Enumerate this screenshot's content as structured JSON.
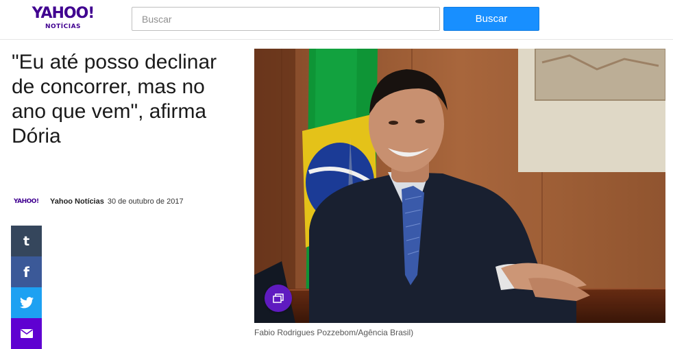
{
  "header": {
    "logo_main": "YAHOO!",
    "logo_sub": "NOTÍCIAS",
    "search_placeholder": "Buscar",
    "search_value": "",
    "search_button": "Buscar"
  },
  "article": {
    "headline": "\"Eu até posso declinar de concorrer, mas no ano que vem\", afirma Dória",
    "byline_logo": "YAHOO!",
    "source": "Yahoo Notícias",
    "date": "30 de outubro de 2017",
    "image_caption": "Fabio Rodrigues Pozzebom/Agência Brasil)"
  },
  "share": {
    "tumblr_glyph": "t",
    "facebook_glyph": "f",
    "icons": [
      "tumblr-icon",
      "facebook-icon",
      "twitter-icon",
      "mail-icon"
    ]
  },
  "photo": {
    "gallery_icon": "gallery-icon"
  },
  "colors": {
    "brand": "#400090",
    "search_button": "#188fff",
    "tumblr": "#35465c",
    "facebook": "#3b5998",
    "twitter": "#1da1f2",
    "mail": "#5f01d1",
    "gallery": "#5f1bc0"
  }
}
